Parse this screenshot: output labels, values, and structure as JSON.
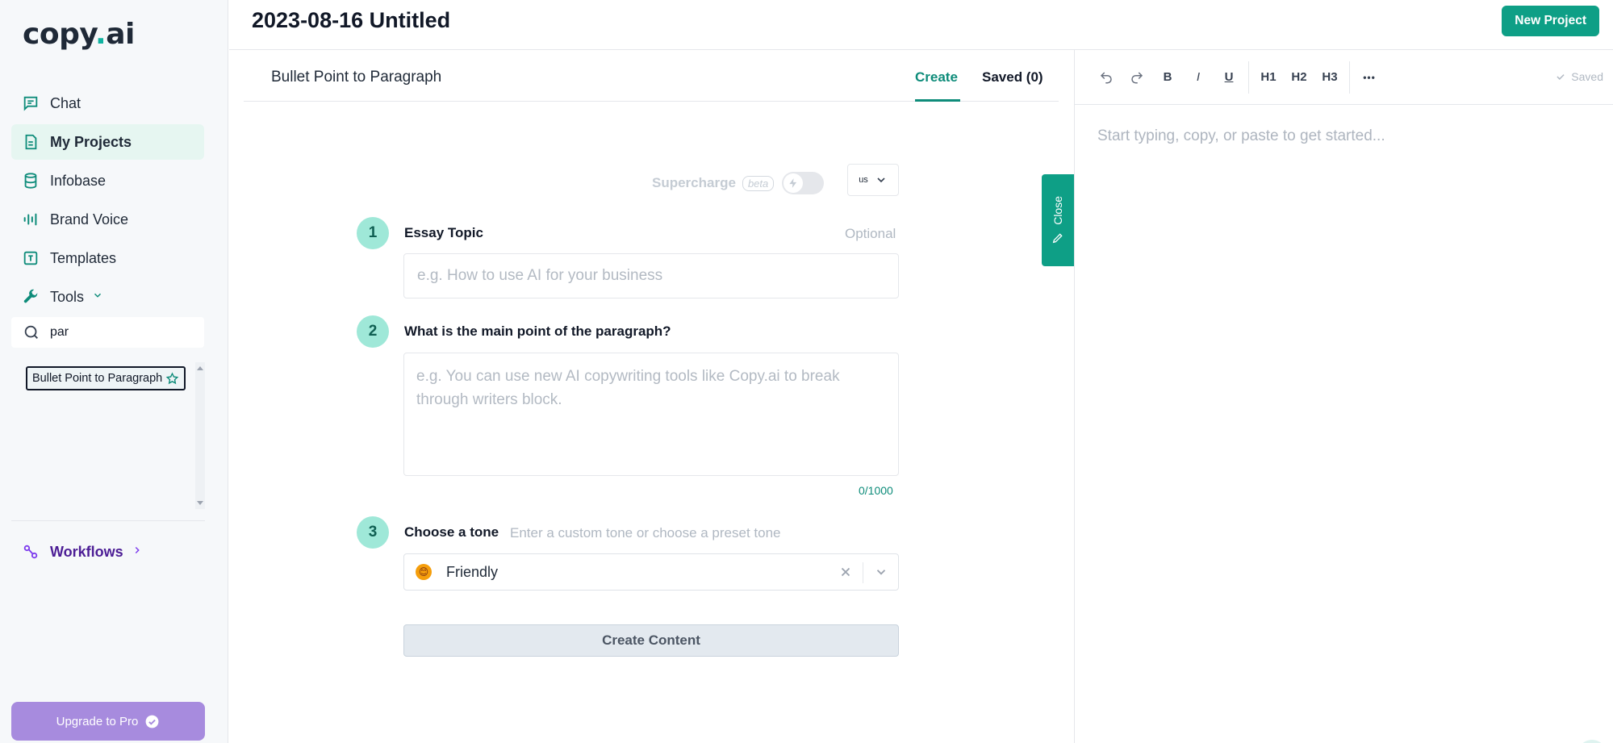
{
  "app": {
    "logo_main": "copy",
    "logo_dot": ".",
    "logo_suffix": "ai"
  },
  "sidebar": {
    "nav": [
      {
        "label": "Chat",
        "icon": "chat-icon"
      },
      {
        "label": "My Projects",
        "icon": "document-icon",
        "active": true
      },
      {
        "label": "Infobase",
        "icon": "database-icon"
      },
      {
        "label": "Brand Voice",
        "icon": "soundwave-icon"
      },
      {
        "label": "Templates",
        "icon": "template-icon"
      },
      {
        "label": "Tools",
        "icon": "wrench-icon"
      }
    ],
    "search": {
      "value": "par",
      "placeholder": ""
    },
    "results": [
      {
        "label": "Bullet Point to Paragraph",
        "icon": "star-icon"
      }
    ],
    "workflows_label": "Workflows",
    "upgrade_label": "Upgrade to Pro"
  },
  "header": {
    "title": "2023-08-16 Untitled",
    "new_project_label": "New Project"
  },
  "tool": {
    "name": "Bullet Point to Paragraph",
    "tabs": {
      "create": "Create",
      "saved": "Saved (0)"
    },
    "supercharge": {
      "label": "Supercharge",
      "badge": "beta",
      "enabled": false
    },
    "language": "us",
    "steps": [
      {
        "number": "1",
        "label": "Essay Topic",
        "optional": "Optional",
        "placeholder": "e.g. How to use AI for your business",
        "value": ""
      },
      {
        "number": "2",
        "label": "What is the main point of the paragraph?",
        "placeholder": "e.g. You can use new AI copywriting tools like Copy.ai to break through writers block.",
        "value": "",
        "char_count": "0/1000"
      },
      {
        "number": "3",
        "label": "Choose a tone",
        "hint": "Enter a custom tone or choose a preset tone",
        "selected": "Friendly",
        "emoji": "😊"
      }
    ],
    "create_label": "Create Content",
    "close_label": "Close"
  },
  "editor": {
    "toolbar": {
      "bold": "B",
      "italic": "I",
      "underline": "U",
      "h1": "H1",
      "h2": "H2",
      "h3": "H3",
      "more": "•••"
    },
    "status": "Saved",
    "placeholder": "Start typing, copy, or paste to get started..."
  },
  "colors": {
    "accent": "#0e9f86",
    "step_circle": "#9fe8d8",
    "upgrade": "#a78bde",
    "workflows": "#4c1d95"
  }
}
